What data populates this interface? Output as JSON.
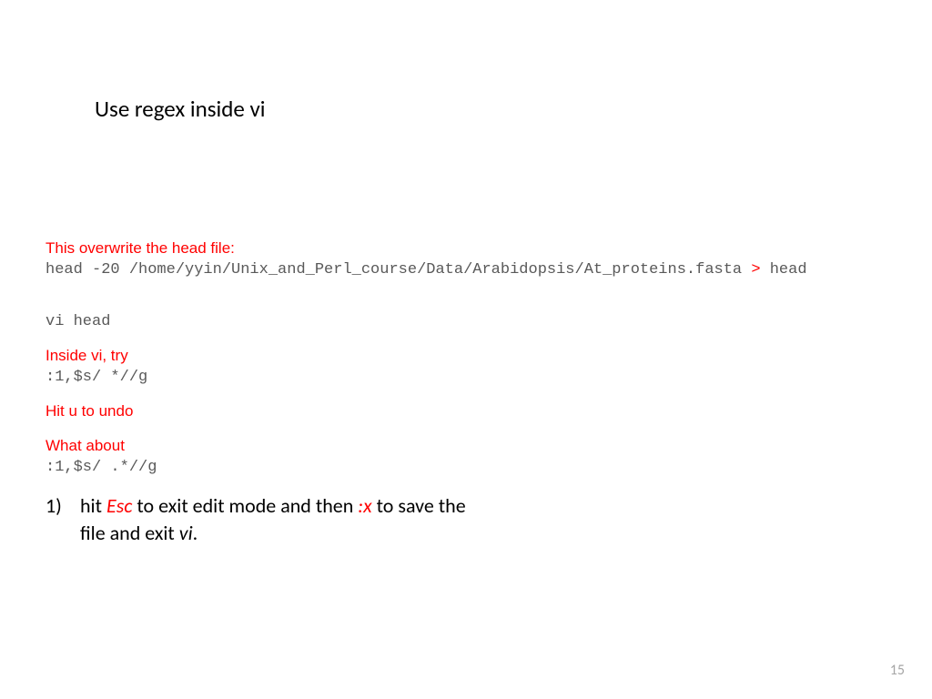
{
  "title": "Use regex inside vi",
  "note1": "This overwrite the head file:",
  "cmd1_a": "head -20 /home/yyin/Unix_and_Perl_course/Data/Arabidopsis/At_proteins.fasta ",
  "cmd1_redirect": ">",
  "cmd1_b": " head",
  "cmd2": "vi head",
  "note2": "Inside vi, try",
  "cmd3": ":1,$s/ *//g",
  "note3": "Hit u to undo",
  "note4": "What about",
  "cmd4": ":1,$s/ .*//g",
  "step": {
    "num": "1)",
    "p1": "hit ",
    "esc": "Esc",
    "p2": " to exit edit mode and then ",
    "x": ":x",
    "p3": " to save the file and exit ",
    "vi": "vi",
    "p4": "."
  },
  "page_number": "15"
}
